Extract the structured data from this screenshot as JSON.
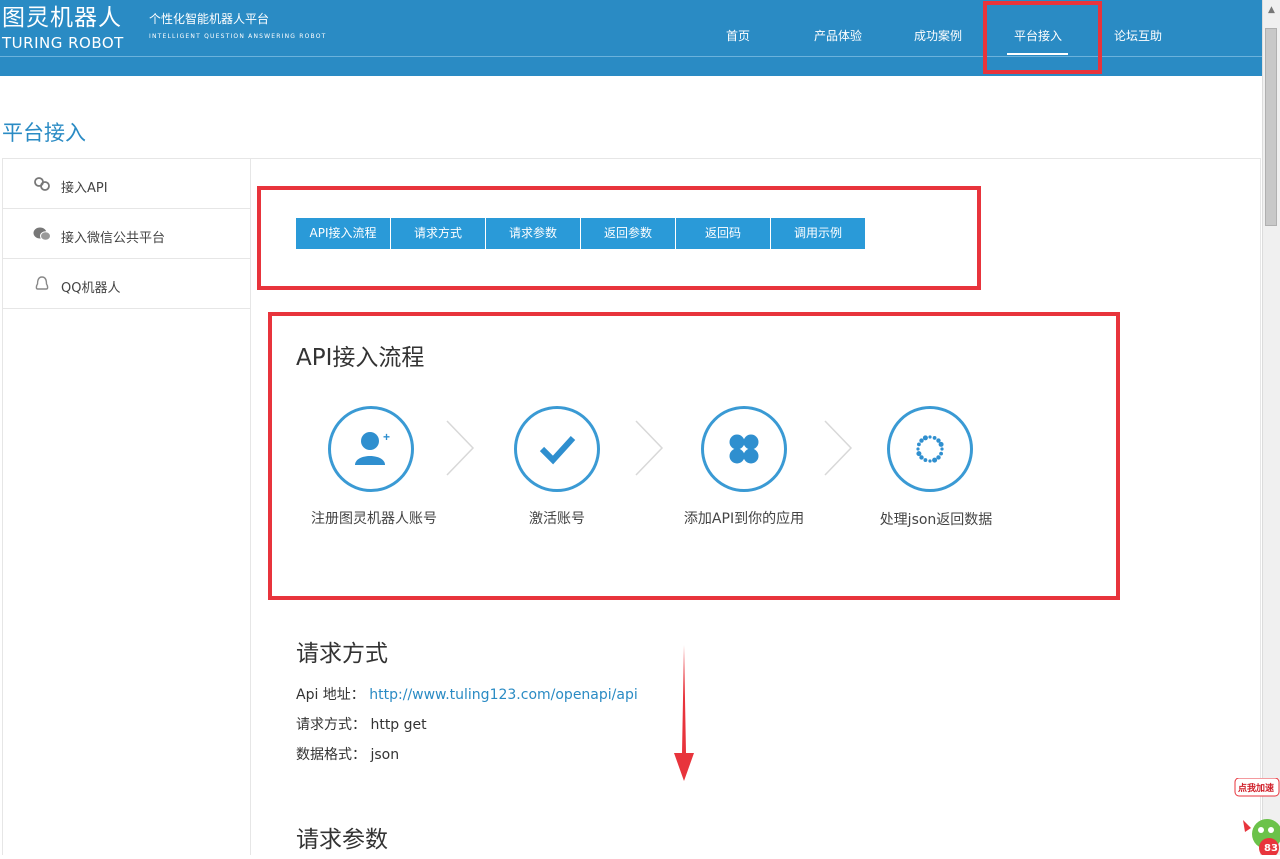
{
  "header": {
    "logo_cn": "图灵机器人",
    "logo_en": "TURING ROBOT",
    "slogan_cn": "个性化智能机器人平台",
    "slogan_en": "INTELLIGENT QUESTION ANSWERING ROBOT",
    "nav": [
      {
        "label": "首页"
      },
      {
        "label": "产品体验"
      },
      {
        "label": "成功案例"
      },
      {
        "label": "平台接入",
        "active": true
      },
      {
        "label": "论坛互助"
      }
    ],
    "bg_color": "#2a8bc4"
  },
  "page_title": "平台接入",
  "sidebar": {
    "items": [
      {
        "label": "接入API",
        "icon": "link-icon"
      },
      {
        "label": "接入微信公共平台",
        "icon": "wechat-icon"
      },
      {
        "label": "QQ机器人",
        "icon": "qq-penguin-icon"
      }
    ]
  },
  "tabs": [
    {
      "label": "API接入流程"
    },
    {
      "label": "请求方式"
    },
    {
      "label": "请求参数"
    },
    {
      "label": "返回参数"
    },
    {
      "label": "返回码"
    },
    {
      "label": "调用示例"
    }
  ],
  "flow": {
    "title": "API接入流程",
    "steps": [
      {
        "label": "注册图灵机器人账号",
        "icon": "add-user-icon"
      },
      {
        "label": "激活账号",
        "icon": "checkmark-icon"
      },
      {
        "label": "添加API到你的应用",
        "icon": "clover-icon"
      },
      {
        "label": "处理json返回数据",
        "icon": "dotted-circle-icon"
      }
    ]
  },
  "request": {
    "title": "请求方式",
    "api_label": "Api 地址：",
    "api_url": "http://www.tuling123.com/openapi/api",
    "method_label": "请求方式：",
    "method_value": "http get",
    "format_label": "数据格式：",
    "format_value": "json"
  },
  "params": {
    "title": "请求参数"
  },
  "badge": {
    "text": "点我加速",
    "count": "83"
  },
  "colors": {
    "accent": "#2a8bc4",
    "tab": "#2a9ad8",
    "highlight": "#e8343c"
  }
}
